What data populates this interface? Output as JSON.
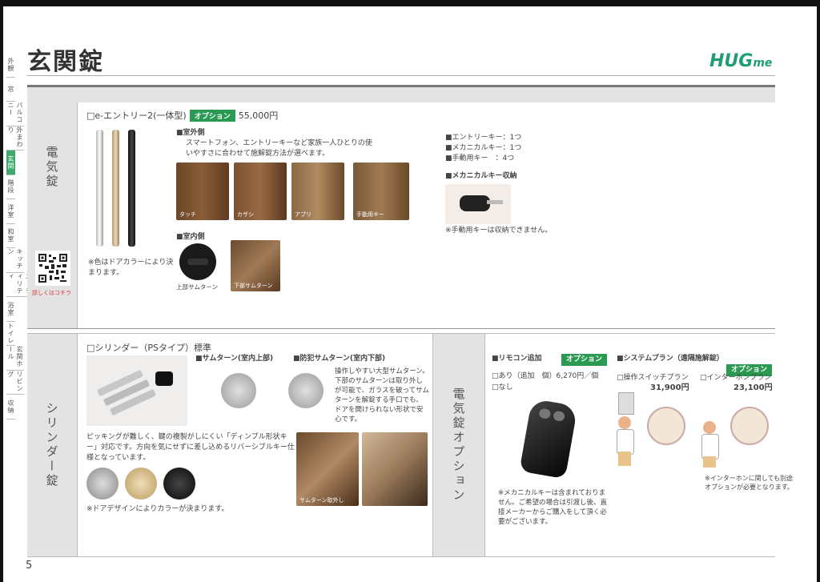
{
  "page_title": "玄関錠",
  "logo": {
    "main": "HUG",
    "sub": "me"
  },
  "page_number": "5",
  "tabs": [
    "外観",
    "窓",
    "バルコニー",
    "外まわり",
    "玄関",
    "階段",
    "洋室",
    "和室",
    "キッチン",
    "ユーティリティ",
    "浴室",
    "トイレ",
    "玄関ホール",
    "リビング",
    "収納"
  ],
  "electric": {
    "section_label": "電気錠",
    "product_title": "□e-エントリー2(一体型)",
    "option_badge": "オプション",
    "price": "55,000円",
    "color_note": "※色はドアカラーにより決まります。",
    "qr_caption": "詳しくはコチラ",
    "outside_head": "■室外側",
    "outside_desc": "スマートフォン、エントリーキーなど家族一人ひとりの使いやすさに合わせて施解錠方法が選べます。",
    "outside_photos": [
      "タッチ",
      "カザシ",
      "アプリ",
      "手動用キー"
    ],
    "inside_head": "■室内側",
    "inside_photos": [
      "上部サムターン",
      "下部サムターン"
    ],
    "keys": [
      "■エントリーキー：1つ",
      "■メカニカルキー：1つ",
      "■手動用キー　：4つ"
    ],
    "storage_head": "■メカニカルキー収納",
    "storage_note": "※手動用キーは収納できません。"
  },
  "cylinder": {
    "section_label": "シリンダー錠",
    "product_title": "□シリンダー（PSタイプ）標準",
    "thumb_top": "■サムターン(室内上部)",
    "thumb_crime": "■防犯サムターン(室内下部)",
    "thumb_desc": "操作しやすい大型サムターン。下部のサムターンは取り外しが可能で、ガラスを破ってサムターンを解錠する手口でも、ドアを開けられない形状で安心です。",
    "key_desc": "ピッキングが難しく、鍵の複製がしにくい「ディンプル形状キー」対応です。方向を気にせずに差し込めるリバーシブルキー仕様となっています。",
    "color_note": "※ドアデザインによりカラーが決まります。",
    "photo_caption": "サムターン取外し"
  },
  "elec_option": {
    "section_label": "電気錠オプション",
    "remote_head": "■リモコン追加",
    "remote_badge": "オプション",
    "remote_yes": "□あり（追加　個）6,270円／個",
    "remote_no": "□なし",
    "remote_note": "※メカニカルキーは含まれておりません。ご希望の場合は引渡し後、直接メーカーからご購入をして頂く必要がございます。",
    "system_head": "■システムプラン（遠隔施解錠）",
    "system_badge": "オプション",
    "switch_plan": "□操作スイッチプラン",
    "switch_price": "31,900円",
    "intercom_plan": "□インターホンプラン",
    "intercom_price": "23,100円",
    "intercom_note": "※インターホンに関しても別途オプションが必要となります。"
  }
}
